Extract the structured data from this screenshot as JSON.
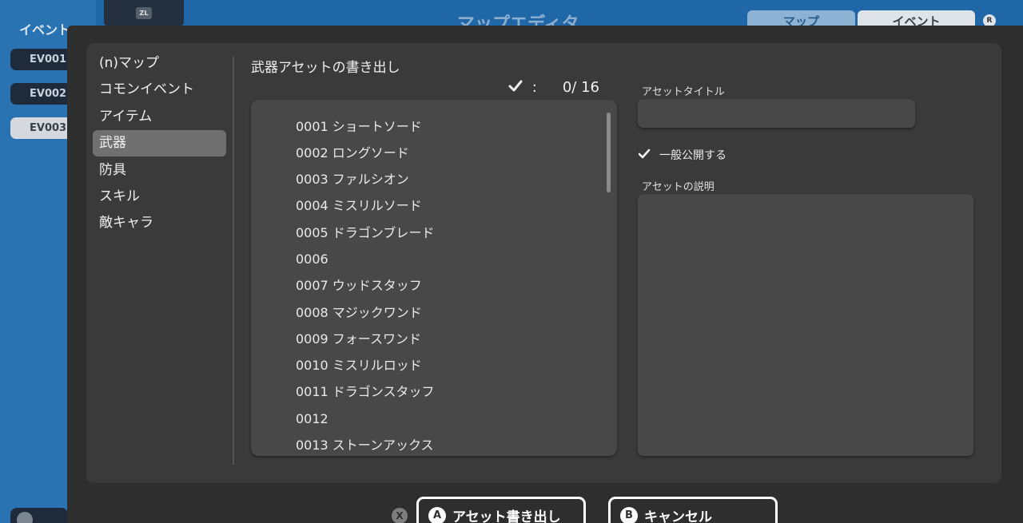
{
  "background": {
    "left_title": "イベント",
    "event_items": [
      "EV001",
      "EV002",
      "EV003"
    ],
    "selected_event": "EV003",
    "zl_label": "ZL",
    "app_title": "マップエディタ",
    "segments": [
      "マップ",
      "イベント"
    ],
    "r_label": "R"
  },
  "categories": [
    "(n)マップ",
    "コモンイベント",
    "アイテム",
    "武器",
    "防具",
    "スキル",
    "敵キャラ"
  ],
  "selected_category": "武器",
  "section_title": "武器アセットの書き出し",
  "counter": {
    "icon": "checkmark-icon",
    "separator": ":",
    "value": "0/ 16"
  },
  "items": [
    "0001 ショートソード",
    "0002 ロングソード",
    "0003 ファルシオン",
    "0004 ミスリルソード",
    "0005 ドラゴンブレード",
    "0006",
    "0007 ウッドスタッフ",
    "0008 マジックワンド",
    "0009 フォースワンド",
    "0010 ミスリルロッド",
    "0011 ドラゴンスタッフ",
    "0012",
    "0013 ストーンアックス"
  ],
  "form": {
    "title_label": "アセットタイトル",
    "title_value": "",
    "public_label": "一般公開する",
    "public_checked": true,
    "desc_label": "アセットの説明",
    "desc_value": ""
  },
  "buttons": {
    "x_label": "X",
    "export_badge": "A",
    "export_label": "アセット書き出し",
    "cancel_badge": "B",
    "cancel_label": "キャンセル"
  },
  "colors": {
    "accent": "#1f67a6",
    "panel": "#3a3a3a",
    "selected": "#707070"
  }
}
